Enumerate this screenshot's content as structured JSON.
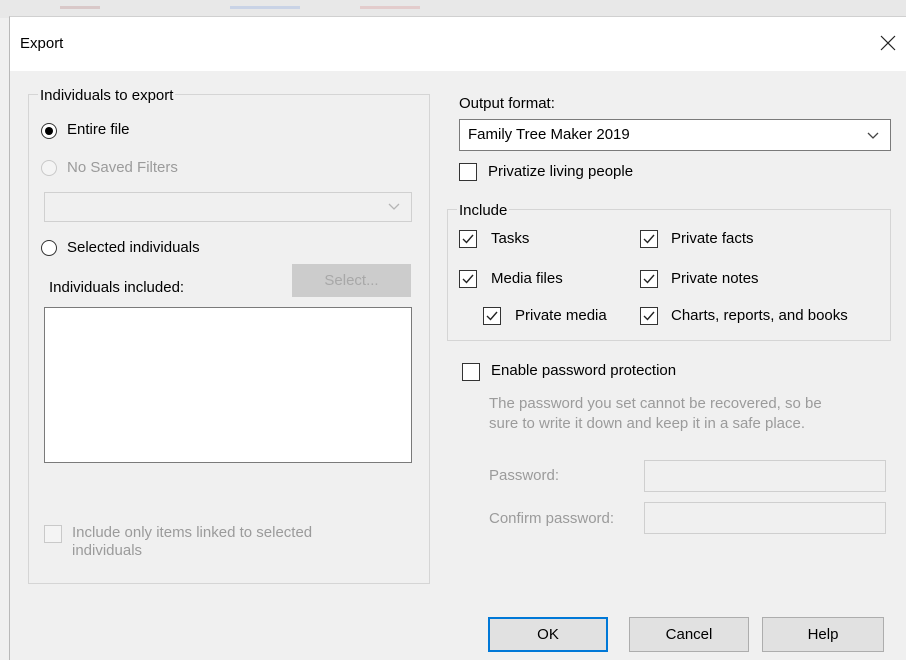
{
  "dialog": {
    "title": "Export"
  },
  "individuals": {
    "group_label": "Individuals to export",
    "entire_file_label": "Entire file",
    "entire_file_checked": true,
    "saved_filters_label": "No Saved Filters",
    "selected_individuals_label": "Selected individuals",
    "individuals_included_label": "Individuals included:",
    "select_button_label": "Select...",
    "include_linked_label_line1": "Include only items linked  to selected",
    "include_linked_label_line2": "individuals"
  },
  "output": {
    "format_label": "Output format:",
    "format_value": "Family Tree Maker 2019",
    "privatize_label": "Privatize living people",
    "privatize_checked": false
  },
  "include": {
    "group_label": "Include",
    "items": [
      {
        "label": "Tasks",
        "checked": true
      },
      {
        "label": "Private facts",
        "checked": true
      },
      {
        "label": "Media files",
        "checked": true
      },
      {
        "label": "Private notes",
        "checked": true
      },
      {
        "label": "Private media",
        "checked": true
      },
      {
        "label": "Charts, reports, and books",
        "checked": true
      }
    ]
  },
  "password": {
    "enable_label": "Enable password protection",
    "enable_checked": false,
    "note_line1": "The password you set cannot be recovered, so be",
    "note_line2": "sure to write it down and keep it in a safe place.",
    "password_label": "Password:",
    "confirm_label": "Confirm password:"
  },
  "buttons": {
    "ok": "OK",
    "cancel": "Cancel",
    "help": "Help"
  }
}
